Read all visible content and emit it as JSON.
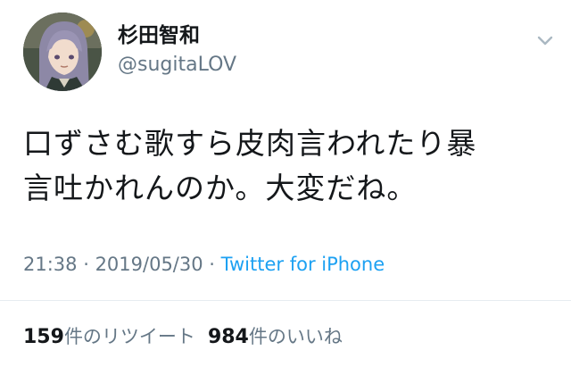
{
  "user": {
    "display_name": "杉田智和",
    "handle": "@sugitaLOV",
    "avatar_icon": "user-avatar-icon"
  },
  "tweet": {
    "text_lines": [
      "口ずさむ歌すら皮肉言われたり暴",
      "言吐かれんのか。大変だね。"
    ],
    "time": "21:38",
    "separator": " · ",
    "date": "2019/05/30",
    "source": "Twitter for iPhone"
  },
  "stats": {
    "retweet_count": "159",
    "retweet_label": "件のリツイート",
    "like_count": "984",
    "like_label": "件のいいね"
  },
  "colors": {
    "text": "#14171a",
    "muted": "#657786",
    "link": "#1da1f2",
    "divider": "#e6ecf0"
  },
  "icons": {
    "menu": "chevron-down-icon"
  }
}
